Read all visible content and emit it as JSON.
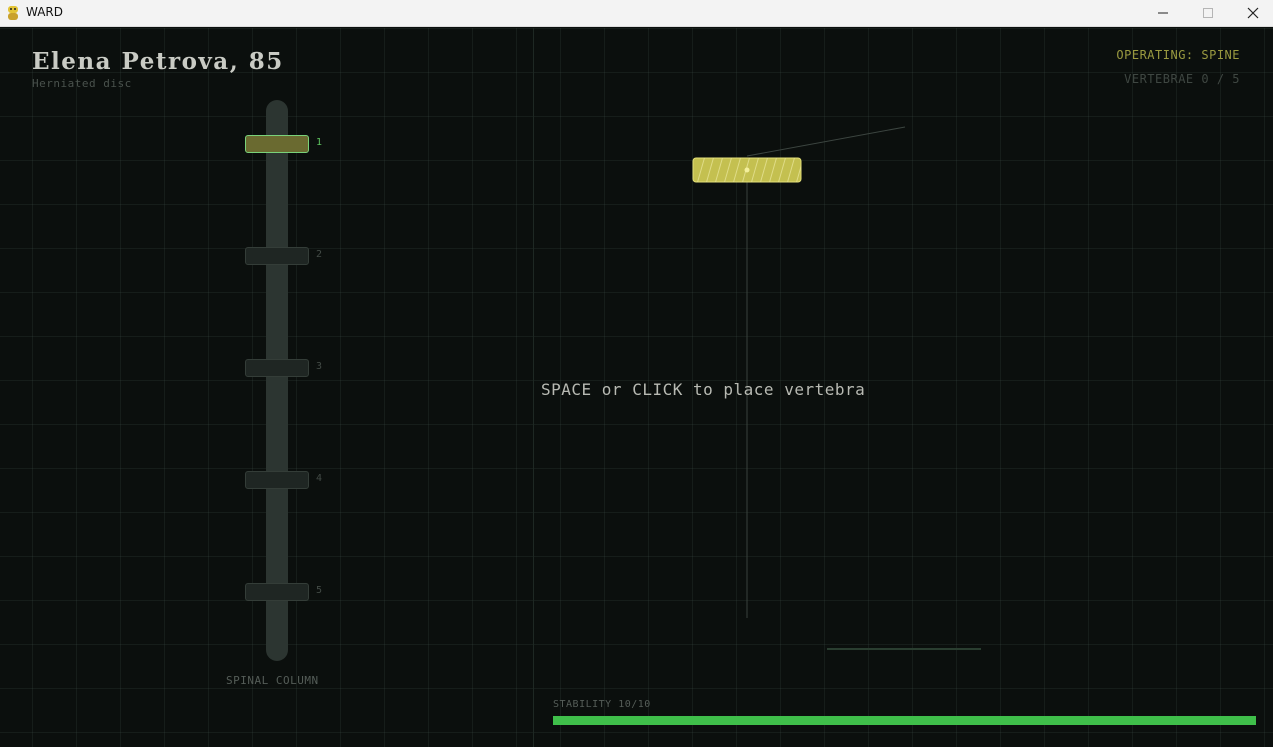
{
  "window": {
    "title": "WARD",
    "app_icon": "python-snake-icon",
    "controls": [
      "minimize-icon",
      "maximize-icon",
      "close-icon"
    ]
  },
  "patient": {
    "name": "Elena Petrova, 85",
    "diagnosis": "Herniated disc"
  },
  "column": {
    "label": "SPINAL COLUMN",
    "slots": [
      "1",
      "2",
      "3",
      "4",
      "5"
    ],
    "active_slot": 1
  },
  "status": {
    "operating": "OPERATING: SPINE",
    "vertebrae": "VERTEBRAE  0 / 5"
  },
  "instruction": "SPACE or CLICK to place vertebra",
  "stability": {
    "label": "STABILITY  10/10",
    "value": 10,
    "max": 10
  },
  "colors": {
    "background": "#0b0f0d",
    "accent_green": "#3fbf4a",
    "accent_yellow": "#c4c050",
    "operating_text": "#9a9a40"
  }
}
